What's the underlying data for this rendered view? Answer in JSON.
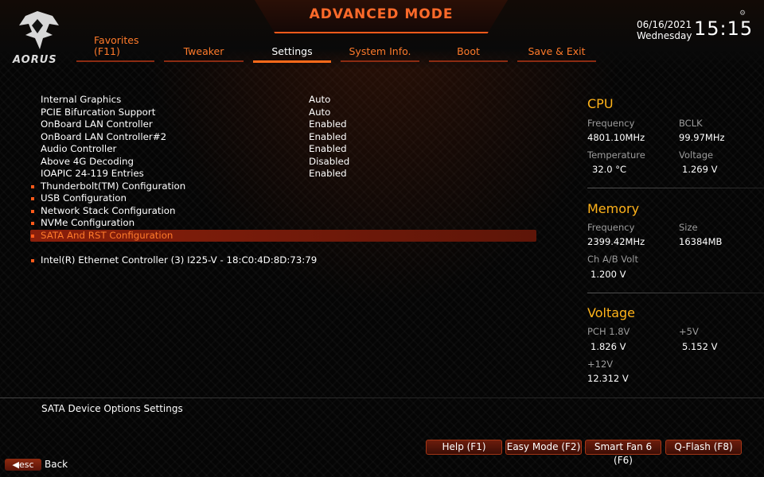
{
  "header": {
    "title": "ADVANCED MODE",
    "brand": "AORUS",
    "date": "06/16/2021",
    "day": "Wednesday",
    "time": "15:15"
  },
  "tabs": [
    {
      "label": "Favorites",
      "sub": "(F11)"
    },
    {
      "label": "Tweaker"
    },
    {
      "label": "Settings",
      "active": true
    },
    {
      "label": "System Info."
    },
    {
      "label": "Boot"
    },
    {
      "label": "Save & Exit"
    }
  ],
  "menu": [
    {
      "label": "Internal Graphics",
      "value": "Auto"
    },
    {
      "label": "PCIE Bifurcation Support",
      "value": "Auto"
    },
    {
      "label": "OnBoard LAN Controller",
      "value": "Enabled"
    },
    {
      "label": "OnBoard LAN Controller#2",
      "value": "Enabled"
    },
    {
      "label": "Audio Controller",
      "value": "Enabled"
    },
    {
      "label": "Above 4G Decoding",
      "value": "Disabled"
    },
    {
      "label": "IOAPIC 24-119 Entries",
      "value": "Enabled"
    },
    {
      "label": "Thunderbolt(TM) Configuration",
      "value": ""
    },
    {
      "label": "USB Configuration",
      "value": ""
    },
    {
      "label": "Network Stack Configuration",
      "value": ""
    },
    {
      "label": "NVMe Configuration",
      "value": ""
    },
    {
      "label": "SATA And RST Configuration",
      "value": ""
    },
    {
      "label": "Intel(R) Ethernet Controller (3) I225-V - 18:C0:4D:8D:73:79",
      "value": ""
    }
  ],
  "cpu": {
    "title": "CPU",
    "freq_label": "Frequency",
    "freq_value": "4801.10MHz",
    "bclk_label": "BCLK",
    "bclk_value": "99.97MHz",
    "temp_label": "Temperature",
    "temp_value": "32.0 °C",
    "volt_label": "Voltage",
    "volt_value": "1.269 V"
  },
  "memory": {
    "title": "Memory",
    "freq_label": "Frequency",
    "freq_value": "2399.42MHz",
    "size_label": "Size",
    "size_value": "16384MB",
    "volt_label": "Ch A/B Volt",
    "volt_value": "1.200 V"
  },
  "voltage": {
    "title": "Voltage",
    "pch_label": "PCH 1.8V",
    "pch_value": "1.826 V",
    "v5_label": "+5V",
    "v5_value": "5.152 V",
    "v12_label": "+12V",
    "v12_value": "12.312 V"
  },
  "help_text": "SATA Device Options Settings",
  "footer": {
    "buttons": [
      "Help (F1)",
      "Easy Mode (F2)",
      "Smart Fan 6 (F6)",
      "Q-Flash (F8)"
    ],
    "esc_label": "esc",
    "back_label": "Back"
  },
  "colors": {
    "accent": "#ff6a1a",
    "section_title": "#ffb31a",
    "selection": "#8a1f0b"
  }
}
